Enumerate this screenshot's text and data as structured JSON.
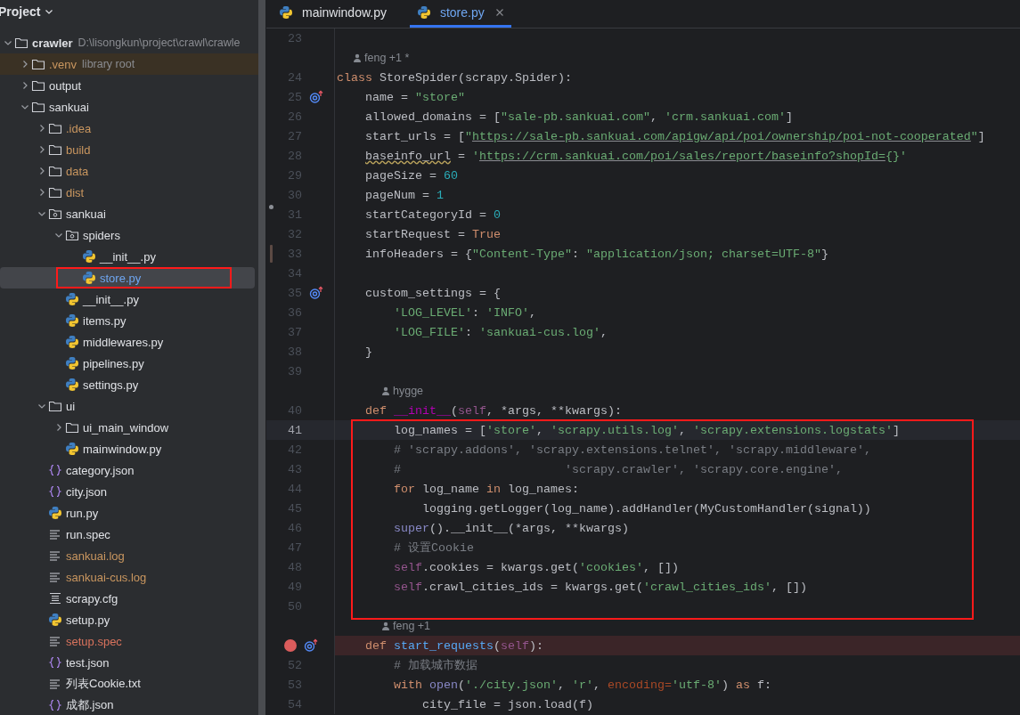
{
  "sidebar": {
    "title": "Project",
    "tree": [
      {
        "name": "crawler",
        "suffix": "D:\\lisongkun\\project\\crawl\\crawle",
        "kind": "folder",
        "color": "#dfe1e5",
        "expanded": true,
        "selected": false,
        "highlighted": false,
        "boxed": false,
        "children": [
          {
            "name": ".venv",
            "suffix": "library root",
            "kind": "folder",
            "color": "#c9965f",
            "expanded": false,
            "selected": false,
            "highlighted": true,
            "boxed": false
          },
          {
            "name": "output",
            "kind": "folder",
            "color": "#dfe1e5",
            "expanded": false,
            "selected": false,
            "highlighted": false,
            "boxed": false
          },
          {
            "name": "sankuai",
            "kind": "folder",
            "color": "#dfe1e5",
            "expanded": true,
            "selected": false,
            "highlighted": false,
            "boxed": false,
            "children": [
              {
                "name": ".idea",
                "kind": "folder",
                "color": "#c9965f",
                "expanded": false,
                "selected": false,
                "highlighted": false,
                "boxed": false
              },
              {
                "name": "build",
                "kind": "folder",
                "color": "#c9965f",
                "expanded": false,
                "selected": false,
                "highlighted": false,
                "boxed": false
              },
              {
                "name": "data",
                "kind": "folder",
                "color": "#c9965f",
                "expanded": false,
                "selected": false,
                "highlighted": false,
                "boxed": false
              },
              {
                "name": "dist",
                "kind": "folder",
                "color": "#c9965f",
                "expanded": false,
                "selected": false,
                "highlighted": false,
                "boxed": false
              },
              {
                "name": "sankuai",
                "kind": "package",
                "color": "#dfe1e5",
                "expanded": true,
                "selected": false,
                "highlighted": false,
                "boxed": false,
                "children": [
                  {
                    "name": "spiders",
                    "kind": "package",
                    "color": "#dfe1e5",
                    "expanded": true,
                    "selected": false,
                    "highlighted": false,
                    "boxed": false,
                    "children": [
                      {
                        "name": "__init__.py",
                        "kind": "python",
                        "color": "#dfe1e5",
                        "selected": false,
                        "highlighted": false,
                        "boxed": false
                      },
                      {
                        "name": "store.py",
                        "kind": "python",
                        "color": "#6fa6f1",
                        "selected": true,
                        "highlighted": false,
                        "boxed": true
                      }
                    ]
                  },
                  {
                    "name": "__init__.py",
                    "kind": "python",
                    "color": "#dfe1e5",
                    "selected": false,
                    "highlighted": false,
                    "boxed": false
                  },
                  {
                    "name": "items.py",
                    "kind": "python",
                    "color": "#dfe1e5",
                    "selected": false,
                    "highlighted": false,
                    "boxed": false
                  },
                  {
                    "name": "middlewares.py",
                    "kind": "python",
                    "color": "#dfe1e5",
                    "selected": false,
                    "highlighted": false,
                    "boxed": false
                  },
                  {
                    "name": "pipelines.py",
                    "kind": "python",
                    "color": "#dfe1e5",
                    "selected": false,
                    "highlighted": false,
                    "boxed": false
                  },
                  {
                    "name": "settings.py",
                    "kind": "python",
                    "color": "#dfe1e5",
                    "selected": false,
                    "highlighted": false,
                    "boxed": false
                  }
                ]
              },
              {
                "name": "ui",
                "kind": "folder",
                "color": "#dfe1e5",
                "expanded": true,
                "selected": false,
                "highlighted": false,
                "boxed": false,
                "children": [
                  {
                    "name": "ui_main_window",
                    "kind": "folder",
                    "color": "#dfe1e5",
                    "expanded": false,
                    "selected": false,
                    "highlighted": false,
                    "boxed": false
                  },
                  {
                    "name": "mainwindow.py",
                    "kind": "python",
                    "color": "#dfe1e5",
                    "selected": false,
                    "highlighted": false,
                    "boxed": false
                  }
                ]
              },
              {
                "name": "category.json",
                "kind": "json",
                "color": "#dfe1e5",
                "selected": false,
                "highlighted": false,
                "boxed": false
              },
              {
                "name": "city.json",
                "kind": "json",
                "color": "#dfe1e5",
                "selected": false,
                "highlighted": false,
                "boxed": false
              },
              {
                "name": "run.py",
                "kind": "python",
                "color": "#dfe1e5",
                "selected": false,
                "highlighted": false,
                "boxed": false
              },
              {
                "name": "run.spec",
                "kind": "text",
                "color": "#dfe1e5",
                "selected": false,
                "highlighted": false,
                "boxed": false
              },
              {
                "name": "sankuai.log",
                "kind": "text",
                "color": "#c9965f",
                "selected": false,
                "highlighted": false,
                "boxed": false
              },
              {
                "name": "sankuai-cus.log",
                "kind": "text",
                "color": "#c9965f",
                "selected": false,
                "highlighted": false,
                "boxed": false
              },
              {
                "name": "scrapy.cfg",
                "kind": "config",
                "color": "#dfe1e5",
                "selected": false,
                "highlighted": false,
                "boxed": false
              },
              {
                "name": "setup.py",
                "kind": "python",
                "color": "#dfe1e5",
                "selected": false,
                "highlighted": false,
                "boxed": false
              },
              {
                "name": "setup.spec",
                "kind": "text",
                "color": "#d9735d",
                "selected": false,
                "highlighted": false,
                "boxed": false
              },
              {
                "name": "test.json",
                "kind": "json",
                "color": "#dfe1e5",
                "selected": false,
                "highlighted": false,
                "boxed": false
              },
              {
                "name": "列表Cookie.txt",
                "kind": "text",
                "color": "#dfe1e5",
                "selected": false,
                "highlighted": false,
                "boxed": false
              },
              {
                "name": "成都.json",
                "kind": "json",
                "color": "#dfe1e5",
                "selected": false,
                "highlighted": false,
                "boxed": false
              }
            ]
          }
        ]
      }
    ]
  },
  "tabs": [
    {
      "label": "mainwindow.py",
      "selected": false,
      "closable": false
    },
    {
      "label": "store.py",
      "selected": true,
      "closable": true
    }
  ],
  "editor": {
    "lines": [
      {
        "number": "23",
        "current": false,
        "breakpoint": false,
        "boxed": false
      },
      {
        "number": "24",
        "author_hint": "feng +1 *",
        "tokens": [
          {
            "kind": "keyword",
            "text": "class"
          },
          {
            "kind": "plain",
            "text": " StoreSpider(scrapy.Spider):"
          }
        ],
        "current": false,
        "breakpoint": false,
        "boxed": false
      },
      {
        "number": "25",
        "gutter": {
          "kind": "override"
        },
        "tokens": [
          {
            "kind": "plain",
            "text": "    name = "
          },
          {
            "kind": "string",
            "text": "\"store\""
          }
        ],
        "current": false,
        "breakpoint": false,
        "boxed": false
      },
      {
        "number": "26",
        "tokens": [
          {
            "kind": "plain",
            "text": "    allowed_domains = ["
          },
          {
            "kind": "string",
            "text": "\"sale-pb.sankuai.com\""
          },
          {
            "kind": "plain",
            "text": ", "
          },
          {
            "kind": "string",
            "text": "'crm.sankuai.com'"
          },
          {
            "kind": "plain",
            "text": "]"
          }
        ],
        "current": false,
        "breakpoint": false,
        "boxed": false
      },
      {
        "number": "27",
        "tokens": [
          {
            "kind": "plain",
            "text": "    start_urls = ["
          },
          {
            "kind": "string",
            "text": "\""
          },
          {
            "kind": "url",
            "text": "https://sale-pb.sankuai.com/apigw/api/poi/ownership/poi-not-cooperated"
          },
          {
            "kind": "string",
            "text": "\""
          },
          {
            "kind": "plain",
            "text": "]"
          }
        ],
        "current": false,
        "breakpoint": false,
        "boxed": false
      },
      {
        "number": "28",
        "tokens": [
          {
            "kind": "warning",
            "text": "    baseinfo_url"
          },
          {
            "kind": "plain",
            "text": " = "
          },
          {
            "kind": "string",
            "text": "'"
          },
          {
            "kind": "url",
            "text": "https://crm.sankuai.com/poi/sales/report/baseinfo?shopId="
          },
          {
            "kind": "string",
            "text": "{}'"
          }
        ],
        "current": false,
        "breakpoint": false,
        "boxed": false
      },
      {
        "number": "29",
        "tokens": [
          {
            "kind": "plain",
            "text": "    pageSize = "
          },
          {
            "kind": "number",
            "text": "60"
          }
        ],
        "current": false,
        "breakpoint": false,
        "boxed": false
      },
      {
        "number": "30",
        "tokens": [
          {
            "kind": "plain",
            "text": "    pageNum = "
          },
          {
            "kind": "number",
            "text": "1"
          }
        ],
        "current": false,
        "breakpoint": false,
        "boxed": false
      },
      {
        "number": "31",
        "change": {
          "kind": "deleted"
        },
        "tokens": [
          {
            "kind": "plain",
            "text": "    startCategoryId = "
          },
          {
            "kind": "number",
            "text": "0"
          }
        ],
        "current": false,
        "breakpoint": false,
        "boxed": false
      },
      {
        "number": "32",
        "tokens": [
          {
            "kind": "plain",
            "text": "    startRequest = "
          },
          {
            "kind": "keyword",
            "text": "True"
          }
        ],
        "current": false,
        "breakpoint": false,
        "boxed": false
      },
      {
        "number": "33",
        "change": {
          "kind": "modified"
        },
        "tokens": [
          {
            "kind": "plain",
            "text": "    infoHeaders = {"
          },
          {
            "kind": "string",
            "text": "\"Content-Type\""
          },
          {
            "kind": "plain",
            "text": ": "
          },
          {
            "kind": "string",
            "text": "\"application/json; charset=UTF-8\""
          },
          {
            "kind": "plain",
            "text": "}"
          }
        ],
        "current": false,
        "breakpoint": false,
        "boxed": false
      },
      {
        "number": "34",
        "current": false,
        "breakpoint": false,
        "boxed": false
      },
      {
        "number": "35",
        "gutter": {
          "kind": "override"
        },
        "tokens": [
          {
            "kind": "plain",
            "text": "    custom_settings = {"
          }
        ],
        "current": false,
        "breakpoint": false,
        "boxed": false
      },
      {
        "number": "36",
        "tokens": [
          {
            "kind": "string",
            "text": "        'LOG_LEVEL'"
          },
          {
            "kind": "plain",
            "text": ": "
          },
          {
            "kind": "string",
            "text": "'INFO'"
          },
          {
            "kind": "plain",
            "text": ","
          }
        ],
        "current": false,
        "breakpoint": false,
        "boxed": false
      },
      {
        "number": "37",
        "tokens": [
          {
            "kind": "string",
            "text": "        'LOG_FILE'"
          },
          {
            "kind": "plain",
            "text": ": "
          },
          {
            "kind": "string",
            "text": "'sankuai-cus.log'"
          },
          {
            "kind": "plain",
            "text": ","
          }
        ],
        "current": false,
        "breakpoint": false,
        "boxed": false
      },
      {
        "number": "38",
        "tokens": [
          {
            "kind": "plain",
            "text": "    }"
          }
        ],
        "current": false,
        "breakpoint": false,
        "boxed": false
      },
      {
        "number": "39",
        "current": false,
        "breakpoint": false,
        "boxed": false
      },
      {
        "number": "40",
        "author_hint": "hygge",
        "tokens": [
          {
            "kind": "keyword",
            "text": "    def"
          },
          {
            "kind": "magic",
            "text": " __init__"
          },
          {
            "kind": "plain",
            "text": "("
          },
          {
            "kind": "self",
            "text": "self"
          },
          {
            "kind": "plain",
            "text": ", *args, **kwargs):"
          }
        ],
        "current": false,
        "breakpoint": false,
        "boxed": false
      },
      {
        "number": "41",
        "tokens": [
          {
            "kind": "plain",
            "text": "        log_names = ["
          },
          {
            "kind": "string",
            "text": "'store'"
          },
          {
            "kind": "plain",
            "text": ", "
          },
          {
            "kind": "string",
            "text": "'scrapy.utils.log'"
          },
          {
            "kind": "plain",
            "text": ", "
          },
          {
            "kind": "string",
            "text": "'scrapy.extensions.logstats'"
          },
          {
            "kind": "plain",
            "text": "]"
          }
        ],
        "current": true,
        "breakpoint": false,
        "boxed": true
      },
      {
        "number": "42",
        "tokens": [
          {
            "kind": "comment",
            "text": "        # 'scrapy.addons', 'scrapy.extensions.telnet', 'scrapy.middleware',"
          }
        ],
        "current": false,
        "breakpoint": false,
        "boxed": true
      },
      {
        "number": "43",
        "tokens": [
          {
            "kind": "comment",
            "text": "        #                       'scrapy.crawler', 'scrapy.core.engine',"
          }
        ],
        "current": false,
        "breakpoint": false,
        "boxed": true
      },
      {
        "number": "44",
        "tokens": [
          {
            "kind": "keyword",
            "text": "        for"
          },
          {
            "kind": "plain",
            "text": " log_name "
          },
          {
            "kind": "keyword",
            "text": "in"
          },
          {
            "kind": "plain",
            "text": " log_names:"
          }
        ],
        "current": false,
        "breakpoint": false,
        "boxed": true
      },
      {
        "number": "45",
        "tokens": [
          {
            "kind": "plain",
            "text": "            logging.getLogger(log_name).addHandler(MyCustomHandler(signal))"
          }
        ],
        "current": false,
        "breakpoint": false,
        "boxed": true
      },
      {
        "number": "46",
        "tokens": [
          {
            "kind": "builtin",
            "text": "        super"
          },
          {
            "kind": "plain",
            "text": "().__init__(*args, **kwargs)"
          }
        ],
        "current": false,
        "breakpoint": false,
        "boxed": true
      },
      {
        "number": "47",
        "tokens": [
          {
            "kind": "comment",
            "text": "        # 设置Cookie"
          }
        ],
        "current": false,
        "breakpoint": false,
        "boxed": true
      },
      {
        "number": "48",
        "tokens": [
          {
            "kind": "self",
            "text": "        self"
          },
          {
            "kind": "plain",
            "text": ".cookies = kwargs.get("
          },
          {
            "kind": "string",
            "text": "'cookies'"
          },
          {
            "kind": "plain",
            "text": ", [])"
          }
        ],
        "current": false,
        "breakpoint": false,
        "boxed": true
      },
      {
        "number": "49",
        "tokens": [
          {
            "kind": "self",
            "text": "        self"
          },
          {
            "kind": "plain",
            "text": ".crawl_cities_ids = kwargs.get("
          },
          {
            "kind": "string",
            "text": "'crawl_cities_ids'"
          },
          {
            "kind": "plain",
            "text": ", [])"
          }
        ],
        "current": false,
        "breakpoint": false,
        "boxed": true
      },
      {
        "number": "50",
        "current": false,
        "breakpoint": false,
        "boxed": true
      },
      {
        "author_hint": "feng +1",
        "gutter": {
          "kind": "override"
        },
        "tokens": [
          {
            "kind": "keyword",
            "text": "    def"
          },
          {
            "kind": "function",
            "text": " start_requests"
          },
          {
            "kind": "plain",
            "text": "("
          },
          {
            "kind": "self",
            "text": "self"
          },
          {
            "kind": "plain",
            "text": "):"
          }
        ],
        "current": false,
        "breakpoint": true,
        "boxed": false
      },
      {
        "number": "52",
        "tokens": [
          {
            "kind": "comment",
            "text": "        # 加载城市数据"
          }
        ],
        "current": false,
        "breakpoint": false,
        "boxed": false
      },
      {
        "number": "53",
        "tokens": [
          {
            "kind": "keyword",
            "text": "        with"
          },
          {
            "kind": "builtin",
            "text": " open"
          },
          {
            "kind": "plain",
            "text": "("
          },
          {
            "kind": "string",
            "text": "'./city.json'"
          },
          {
            "kind": "plain",
            "text": ", "
          },
          {
            "kind": "string",
            "text": "'r'"
          },
          {
            "kind": "plain",
            "text": ", "
          },
          {
            "kind": "param",
            "text": "encoding="
          },
          {
            "kind": "string",
            "text": "'utf-8'"
          },
          {
            "kind": "plain",
            "text": ") "
          },
          {
            "kind": "keyword",
            "text": "as"
          },
          {
            "kind": "plain",
            "text": " f:"
          }
        ],
        "current": false,
        "breakpoint": false,
        "boxed": false
      },
      {
        "number": "54",
        "tokens": [
          {
            "kind": "plain",
            "text": "            city_file = json.load(f)"
          }
        ],
        "current": false,
        "breakpoint": false,
        "boxed": false
      }
    ]
  }
}
